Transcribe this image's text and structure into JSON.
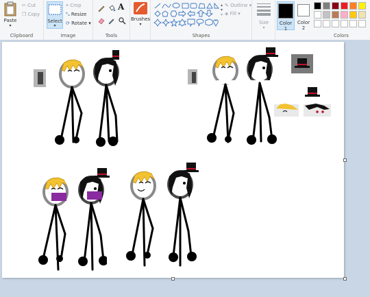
{
  "ribbon": {
    "clipboard": {
      "paste_label": "Paste",
      "cut_label": "Cut",
      "copy_label": "Copy",
      "group_label": "Clipboard"
    },
    "image": {
      "select_label": "Select",
      "crop_label": "Crop",
      "resize_label": "Resize",
      "rotate_label": "Rotate",
      "group_label": "Image"
    },
    "tools": {
      "group_label": "Tools"
    },
    "brushes": {
      "label": "Brushes"
    },
    "shapes": {
      "outline_label": "Outline",
      "fill_label": "Fill",
      "group_label": "Shapes"
    },
    "size": {
      "label": "Size"
    },
    "color1": {
      "label": "Color",
      "sub": "1",
      "color": "#000000"
    },
    "color2": {
      "label": "Color",
      "sub": "2",
      "color": "#ffffff"
    },
    "colors": {
      "group_label": "Colors",
      "row1": [
        "#000000",
        "#7f7f7f",
        "#880015",
        "#ed1c24",
        "#ff7f27",
        "#fff200"
      ],
      "row2": [
        "#ffffff",
        "#c3c3c3",
        "#b97a57",
        "#ffaec9",
        "#ffc90e",
        "#efe4b0"
      ],
      "row3": [
        "#ffffff",
        "#ffffff",
        "#ffffff",
        "#ffffff",
        "#ffffff",
        "#ffffff"
      ]
    }
  },
  "canvas": {
    "background": "#ffffff"
  }
}
